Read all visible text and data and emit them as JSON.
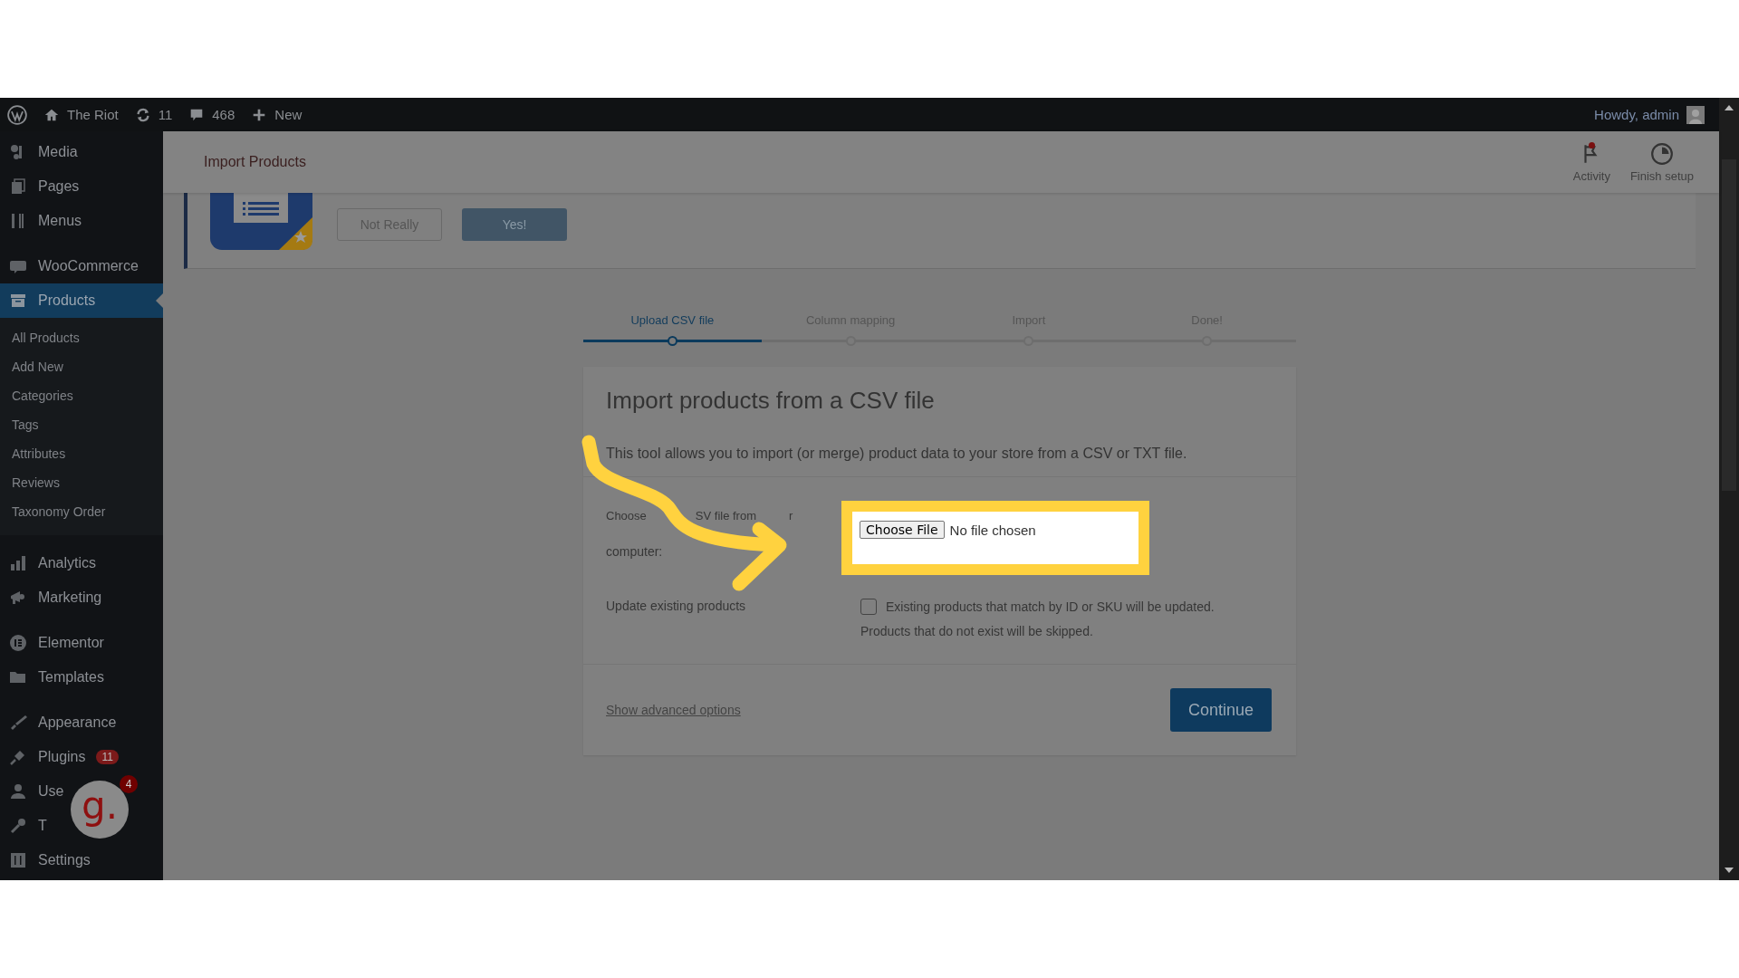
{
  "admin_bar": {
    "site": "The Riot",
    "updates": "11",
    "comments": "468",
    "new": "New",
    "greeting": "Howdy, admin"
  },
  "sidebar": {
    "items": [
      {
        "label": "Media",
        "selected": false
      },
      {
        "label": "Pages",
        "selected": false
      },
      {
        "label": "Menus",
        "selected": false
      },
      {
        "label": "WooCommerce",
        "selected": false
      },
      {
        "label": "Products",
        "selected": true,
        "children": [
          {
            "label": "All Products",
            "selected": false
          },
          {
            "label": "Add New",
            "selected": false
          },
          {
            "label": "Categories",
            "selected": false
          },
          {
            "label": "Tags",
            "selected": false
          },
          {
            "label": "Attributes",
            "selected": false
          },
          {
            "label": "Reviews",
            "selected": false
          },
          {
            "label": "Taxonomy Order",
            "selected": false
          }
        ]
      },
      {
        "label": "Analytics",
        "selected": false
      },
      {
        "label": "Marketing",
        "selected": false
      },
      {
        "label": "Elementor",
        "selected": false
      },
      {
        "label": "Templates",
        "selected": false
      },
      {
        "label": "Appearance",
        "selected": false
      },
      {
        "label": "Plugins",
        "selected": false,
        "badge": "11"
      },
      {
        "label": "Use",
        "selected": false
      },
      {
        "label": "T",
        "selected": false
      },
      {
        "label": "Settings",
        "selected": false
      }
    ]
  },
  "floating_widget": {
    "logo": "g.",
    "count": "4"
  },
  "header": {
    "title": "Import Products",
    "actions": [
      {
        "label": "Activity",
        "notification": true
      },
      {
        "label": "Finish setup",
        "notification": false
      }
    ]
  },
  "notice": {
    "buttons": [
      {
        "label": "Not Really",
        "kind": "secondary"
      },
      {
        "label": "Yes!",
        "kind": "primary"
      }
    ]
  },
  "steps": [
    {
      "label": "Upload CSV file",
      "selected": true
    },
    {
      "label": "Column mapping",
      "selected": false
    },
    {
      "label": "Import",
      "selected": false
    },
    {
      "label": "Done!",
      "selected": false
    }
  ],
  "card": {
    "title": "Import products from a CSV file",
    "description": "This tool allows you to import (or merge) product data to your store from a CSV or TXT file.",
    "file_row": {
      "label_parts": [
        "Choose",
        "SV file from",
        "r"
      ],
      "label_line2": "computer:",
      "button": "Choose File",
      "status": "No file chosen",
      "highlighted": true
    },
    "update_row": {
      "label": "Update existing products",
      "checked": false,
      "text": "Existing products that match by ID or SKU will be updated.",
      "note": "Products that do not exist will be skipped."
    },
    "footer": {
      "link": "Show advanced options",
      "button": "Continue"
    }
  }
}
